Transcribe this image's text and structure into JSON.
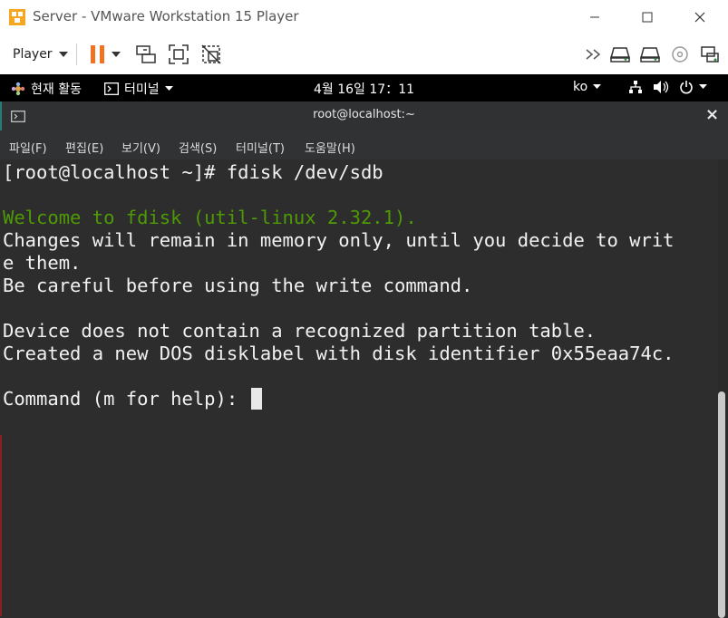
{
  "window": {
    "title": "Server - VMware Workstation 15 Player",
    "minimize_glyph": "─",
    "maximize_glyph": "☐",
    "close_glyph": "✕"
  },
  "toolbar": {
    "player_label": "Player",
    "icons": [
      "pause-icon",
      "dropdown-arrow-icon",
      "send-ctrl-alt-del-icon",
      "full-screen-icon",
      "unity-icon",
      "forward-icon",
      "hard-disk-icon",
      "hard-disk-2-icon",
      "cd-dvd-icon",
      "network-adapter-icon"
    ],
    "accent_color": "#f07321"
  },
  "gnome_topbar": {
    "activities_label": "현재 활동",
    "app_menu_label": "터미널",
    "clock": "4월 16일  17：11",
    "input_method": "ko",
    "icons": [
      "activities-icon",
      "terminal-app-icon",
      "network-icon",
      "volume-icon",
      "power-icon"
    ]
  },
  "terminal": {
    "title": "root@localhost:~",
    "close_label": "×",
    "menu": [
      "파일(F)",
      "편집(E)",
      "보기(V)",
      "검색(S)",
      "터미널(T)",
      "도움말(H)"
    ],
    "lines": [
      "[root@localhost ~]# fdisk /dev/sdb",
      "",
      "Welcome to fdisk (util-linux 2.32.1).",
      "Changes will remain in memory only, until you decide to writ",
      "e them.",
      "Be careful before using the write command.",
      "",
      "Device does not contain a recognized partition table.",
      "Created a new DOS disklabel with disk identifier 0x55eaa74c.",
      "",
      "Command (m for help): "
    ],
    "colors": {
      "background": "#2d2d2d",
      "foreground": "#f2f2f2",
      "welcome_green": "#4e9a06"
    }
  }
}
